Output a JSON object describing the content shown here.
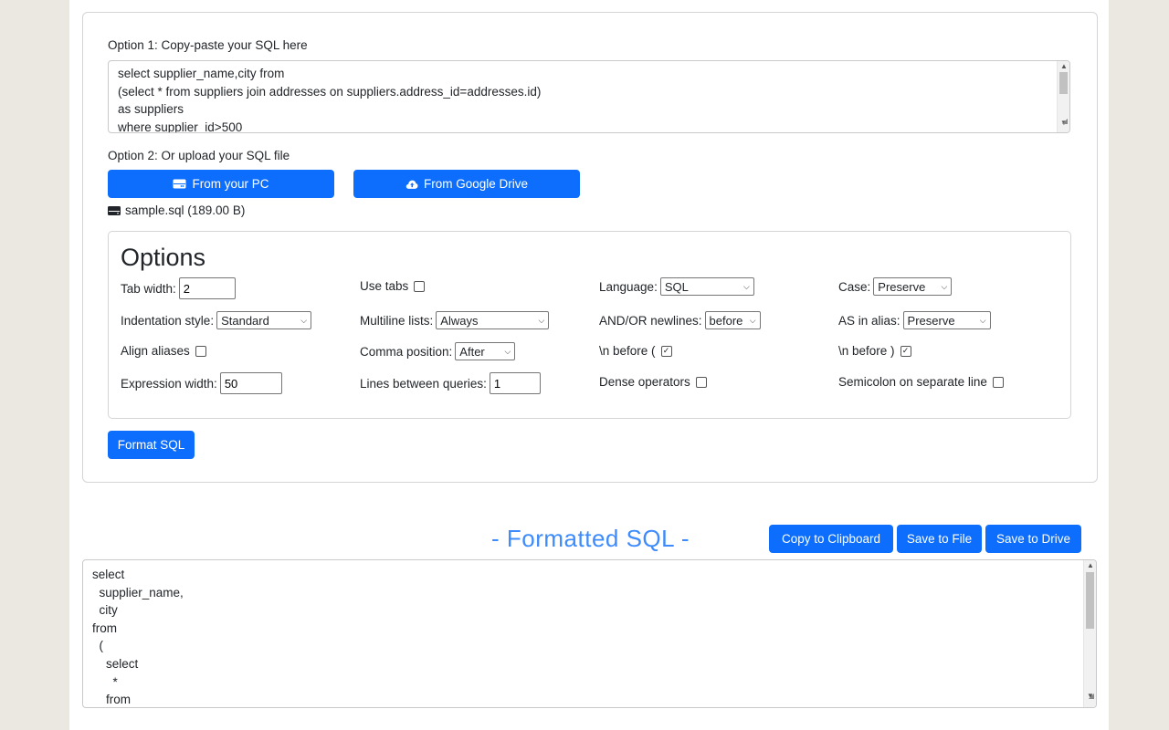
{
  "input": {
    "option1_label": "Option 1: Copy-paste your SQL here",
    "sql_lines": [
      "select supplier_name,city from",
      "(select * from suppliers join addresses on suppliers.address_id=addresses.id)",
      "as suppliers",
      "where supplier_id>500"
    ],
    "option2_label": "Option 2: Or upload your SQL file",
    "from_pc_label": "From your PC",
    "from_drive_label": "From Google Drive",
    "file_name": "sample.sql (189.00 B)"
  },
  "options": {
    "title": "Options",
    "tab_width_label": "Tab width:",
    "tab_width_value": "2",
    "use_tabs_label": "Use tabs",
    "language_label": "Language:",
    "language_value": "SQL",
    "case_label": "Case:",
    "case_value": "Preserve",
    "indentation_label": "Indentation style:",
    "indentation_value": "Standard",
    "multiline_label": "Multiline lists:",
    "multiline_value": "Always",
    "andor_label": "AND/OR newlines:",
    "andor_value": "before",
    "as_alias_label": "AS in alias:",
    "as_alias_value": "Preserve",
    "align_aliases_label": "Align aliases",
    "comma_label": "Comma position:",
    "comma_value": "After",
    "nl_before_open_label": "\\n before (",
    "nl_before_close_label": "\\n before )",
    "expr_width_label": "Expression width:",
    "expr_width_value": "50",
    "lines_between_label": "Lines between queries:",
    "lines_between_value": "1",
    "dense_label": "Dense operators",
    "semicolon_label": "Semicolon on separate line",
    "format_button": "Format SQL"
  },
  "output": {
    "title": "- Formatted SQL -",
    "copy_label": "Copy to Clipboard",
    "save_file_label": "Save to File",
    "save_drive_label": "Save to Drive",
    "lines": [
      "select",
      "  supplier_name,",
      "  city",
      "from",
      "  (",
      "    select",
      "      *",
      "    from"
    ]
  },
  "colors": {
    "primary": "#0d6efd",
    "title_blue": "#3d8bfd",
    "background": "#ebe8e1"
  }
}
